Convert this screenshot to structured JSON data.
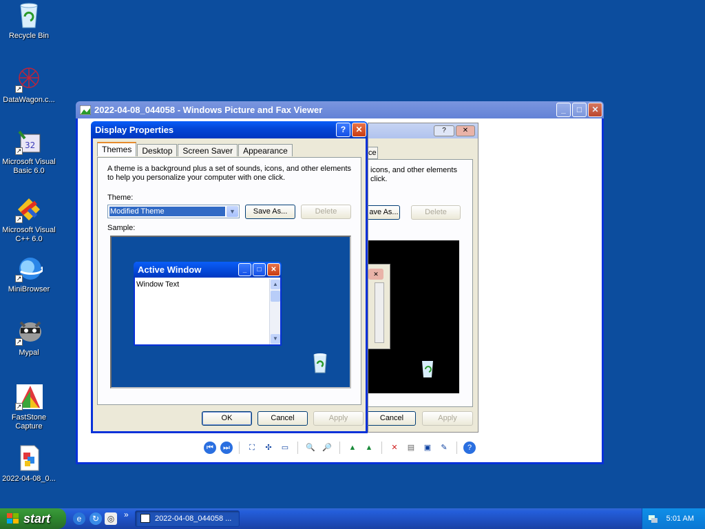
{
  "colors": {
    "desktop": "#0c4d9e",
    "title_active": "#0447d8",
    "title_inactive": "#7a96df",
    "dialog_bg": "#ece9d8",
    "start_green": "#2f8b2f"
  },
  "desktop_icons": [
    {
      "label": "Recycle Bin",
      "icon": "recycle-bin-icon"
    },
    {
      "label": "DataWagon.c...",
      "icon": "datawagon-icon"
    },
    {
      "label": "Microsoft Visual Basic 6.0",
      "icon": "visual-basic-icon"
    },
    {
      "label": "Microsoft Visual C++ 6.0",
      "icon": "visual-cpp-icon"
    },
    {
      "label": "MiniBrowser",
      "icon": "minibrowser-icon"
    },
    {
      "label": "Mypal",
      "icon": "mypal-raccoon-icon"
    },
    {
      "label": "FastStone Capture",
      "icon": "faststone-capture-icon"
    },
    {
      "label": "2022-04-08_0...",
      "icon": "image-file-icon"
    }
  ],
  "viewer": {
    "title": "2022-04-08_044058 - Windows Picture and Fax Viewer",
    "toolbar_icons": [
      "previous-image-icon",
      "next-image-icon",
      "best-fit-icon",
      "actual-size-icon",
      "slideshow-icon",
      "zoom-in-icon",
      "zoom-out-icon",
      "rotate-clockwise-icon",
      "rotate-counterclockwise-icon",
      "delete-icon",
      "print-icon",
      "save-icon",
      "edit-icon",
      "help-icon"
    ]
  },
  "ghost": {
    "tab_fragment": "ce",
    "desc_fragment": "icons, and other elements",
    "desc_fragment2": "click.",
    "save_as_fragment": "ave As...",
    "delete_label": "Delete",
    "cancel_label": "Cancel",
    "apply_label": "Apply"
  },
  "dialog": {
    "title": "Display Properties",
    "tabs": [
      "Themes",
      "Desktop",
      "Screen Saver",
      "Appearance"
    ],
    "description": "A theme is a background plus a set of sounds, icons, and other elements to help you personalize your computer with one click.",
    "theme_label": "Theme:",
    "theme_value": "Modified Theme",
    "save_as": "Save As...",
    "delete": "Delete",
    "sample_label": "Sample:",
    "sample_window_title": "Active Window",
    "sample_window_text": "Window Text",
    "ok": "OK",
    "cancel": "Cancel",
    "apply": "Apply"
  },
  "taskbar": {
    "start": "start",
    "quick_launch": [
      "internet-explorer-icon",
      "refresh-browser-icon",
      "quick-launch-app-icon"
    ],
    "chevron": "»",
    "task_item": "2022-04-08_044058 ...",
    "clock": "5:01 AM"
  }
}
